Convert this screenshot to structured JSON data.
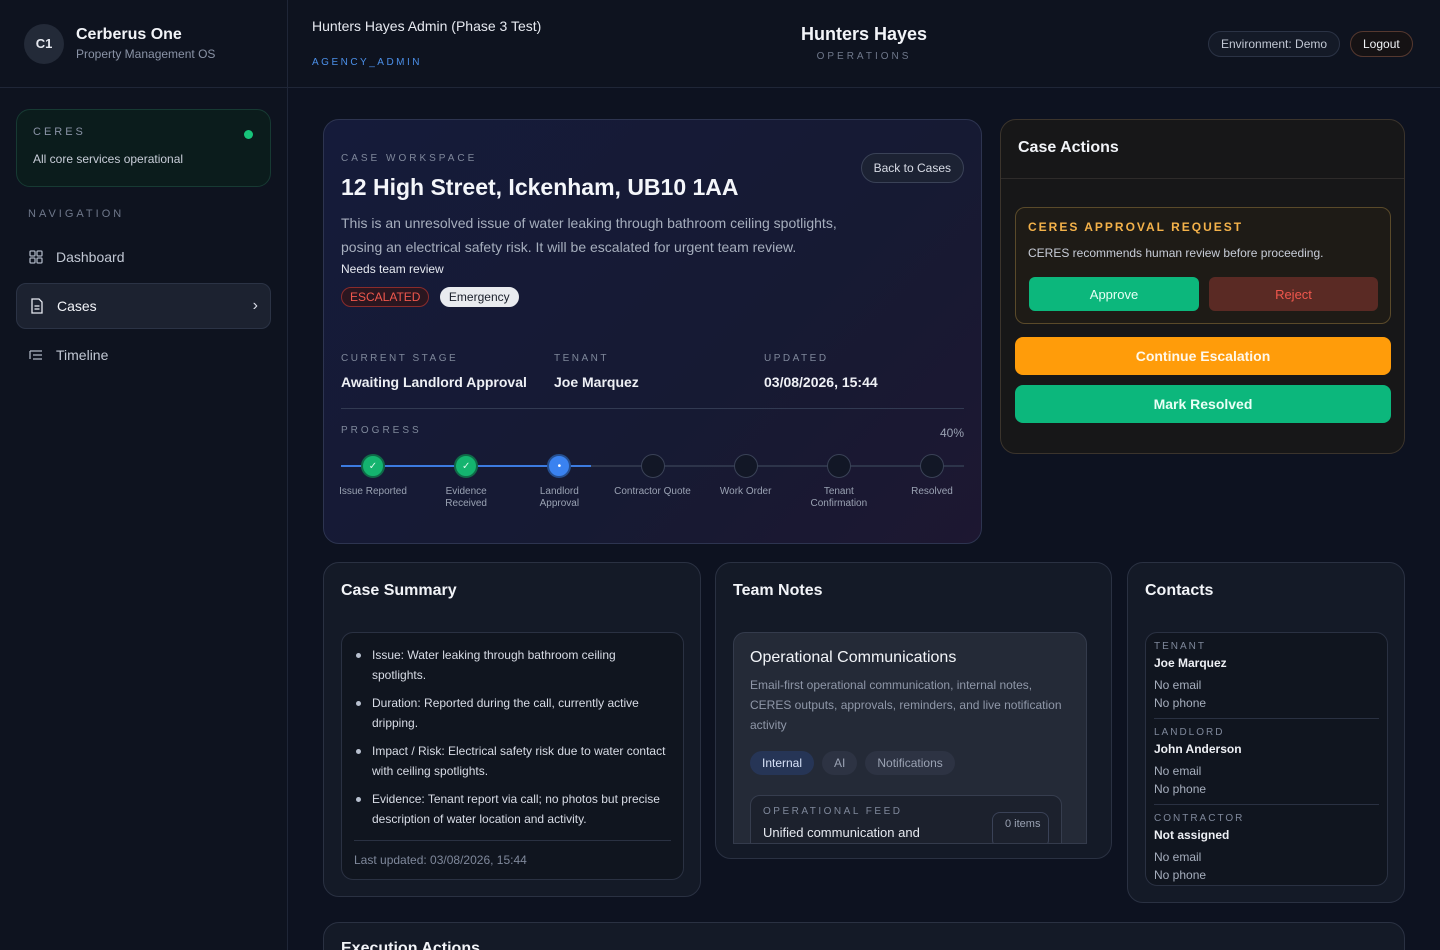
{
  "brand": {
    "badge": "C1",
    "name": "Cerberus One",
    "subtitle": "Property Management OS"
  },
  "ceres": {
    "label": "CERES",
    "status": "All core services operational",
    "status_color": "#17c47a"
  },
  "nav": {
    "heading": "NAVIGATION",
    "items": [
      {
        "label": "Dashboard",
        "icon": "grid-icon"
      },
      {
        "label": "Cases",
        "icon": "document-icon",
        "active": true
      },
      {
        "label": "Timeline",
        "icon": "list-icon"
      }
    ]
  },
  "header": {
    "title": "Hunters Hayes Admin (Phase 3 Test)",
    "role": "AGENCY_ADMIN",
    "center_title": "Hunters Hayes",
    "center_subtitle": "OPERATIONS",
    "environment": "Environment: Demo",
    "logout": "Logout"
  },
  "workspace": {
    "eyebrow": "CASE WORKSPACE",
    "title": "12 High Street, Ickenham, UB10 1AA",
    "description": "This is an unresolved issue of water leaking through bathroom ceiling spotlights, posing an electrical safety risk. It will be escalated for urgent team review.",
    "review_note": "Needs team review",
    "back_button": "Back to Cases",
    "badges": {
      "status": "ESCALATED",
      "priority": "Emergency"
    },
    "meta": {
      "stage_label": "CURRENT STAGE",
      "stage_value": "Awaiting Landlord Approval",
      "tenant_label": "TENANT",
      "tenant_value": "Joe Marquez",
      "updated_label": "UPDATED",
      "updated_value": "03/08/2026, 15:44"
    },
    "progress": {
      "label": "PROGRESS",
      "percent_text": "40%",
      "percent": 40,
      "steps": [
        {
          "name": "Issue Reported",
          "state": "done"
        },
        {
          "name": "Evidence Received",
          "state": "done"
        },
        {
          "name": "Landlord Approval",
          "state": "current"
        },
        {
          "name": "Contractor Quote",
          "state": "todo"
        },
        {
          "name": "Work Order",
          "state": "todo"
        },
        {
          "name": "Tenant Confirmation",
          "state": "todo"
        },
        {
          "name": "Resolved",
          "state": "todo"
        }
      ]
    }
  },
  "actions": {
    "title": "Case Actions",
    "approval": {
      "title": "CERES APPROVAL REQUEST",
      "text": "CERES recommends human review before proceeding.",
      "approve": "Approve",
      "reject": "Reject"
    },
    "continue": "Continue Escalation",
    "resolve": "Mark Resolved"
  },
  "summary": {
    "title": "Case Summary",
    "items": [
      "Issue: Water leaking through bathroom ceiling spotlights.",
      "Duration: Reported during the call, currently active dripping.",
      "Impact / Risk: Electrical safety risk due to water contact with ceiling spotlights.",
      "Evidence: Tenant report via call; no photos but precise description of water location and activity."
    ],
    "footer": "Last updated: 03/08/2026, 15:44"
  },
  "notes": {
    "title": "Team Notes",
    "panel_title": "Operational Communications",
    "panel_desc": "Email-first operational communication, internal notes, CERES outputs, approvals, reminders, and live notification activity",
    "tabs": [
      "Internal",
      "AI",
      "Notifications"
    ],
    "feed": {
      "label": "OPERATIONAL FEED",
      "title": "Unified communication and",
      "count": "0 items"
    }
  },
  "contacts": {
    "title": "Contacts",
    "items": [
      {
        "role": "TENANT",
        "name": "Joe Marquez",
        "email": "No email",
        "phone": "No phone"
      },
      {
        "role": "LANDLORD",
        "name": "John Anderson",
        "email": "No email",
        "phone": "No phone"
      },
      {
        "role": "CONTRACTOR",
        "name": "Not assigned",
        "email": "No email",
        "phone": "No phone"
      }
    ]
  },
  "execution": {
    "title": "Execution Actions"
  }
}
